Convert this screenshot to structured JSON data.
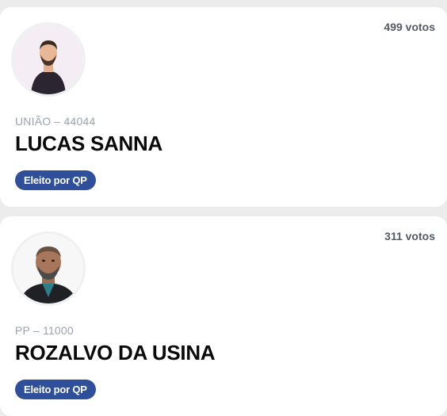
{
  "candidates": [
    {
      "votes": "499 votos",
      "party_number": "UNIÃO – 44044",
      "name": "LUCAS SANNA",
      "status": "Eleito por QP",
      "photo": "candidate-photo"
    },
    {
      "votes": "311 votos",
      "party_number": "PP – 11000",
      "name": "ROZALVO DA USINA",
      "status": "Eleito por QP",
      "photo": "candidate-photo"
    }
  ],
  "colors": {
    "badge": "#2f4f9a",
    "card": "#ffffff",
    "background": "#ececec"
  }
}
